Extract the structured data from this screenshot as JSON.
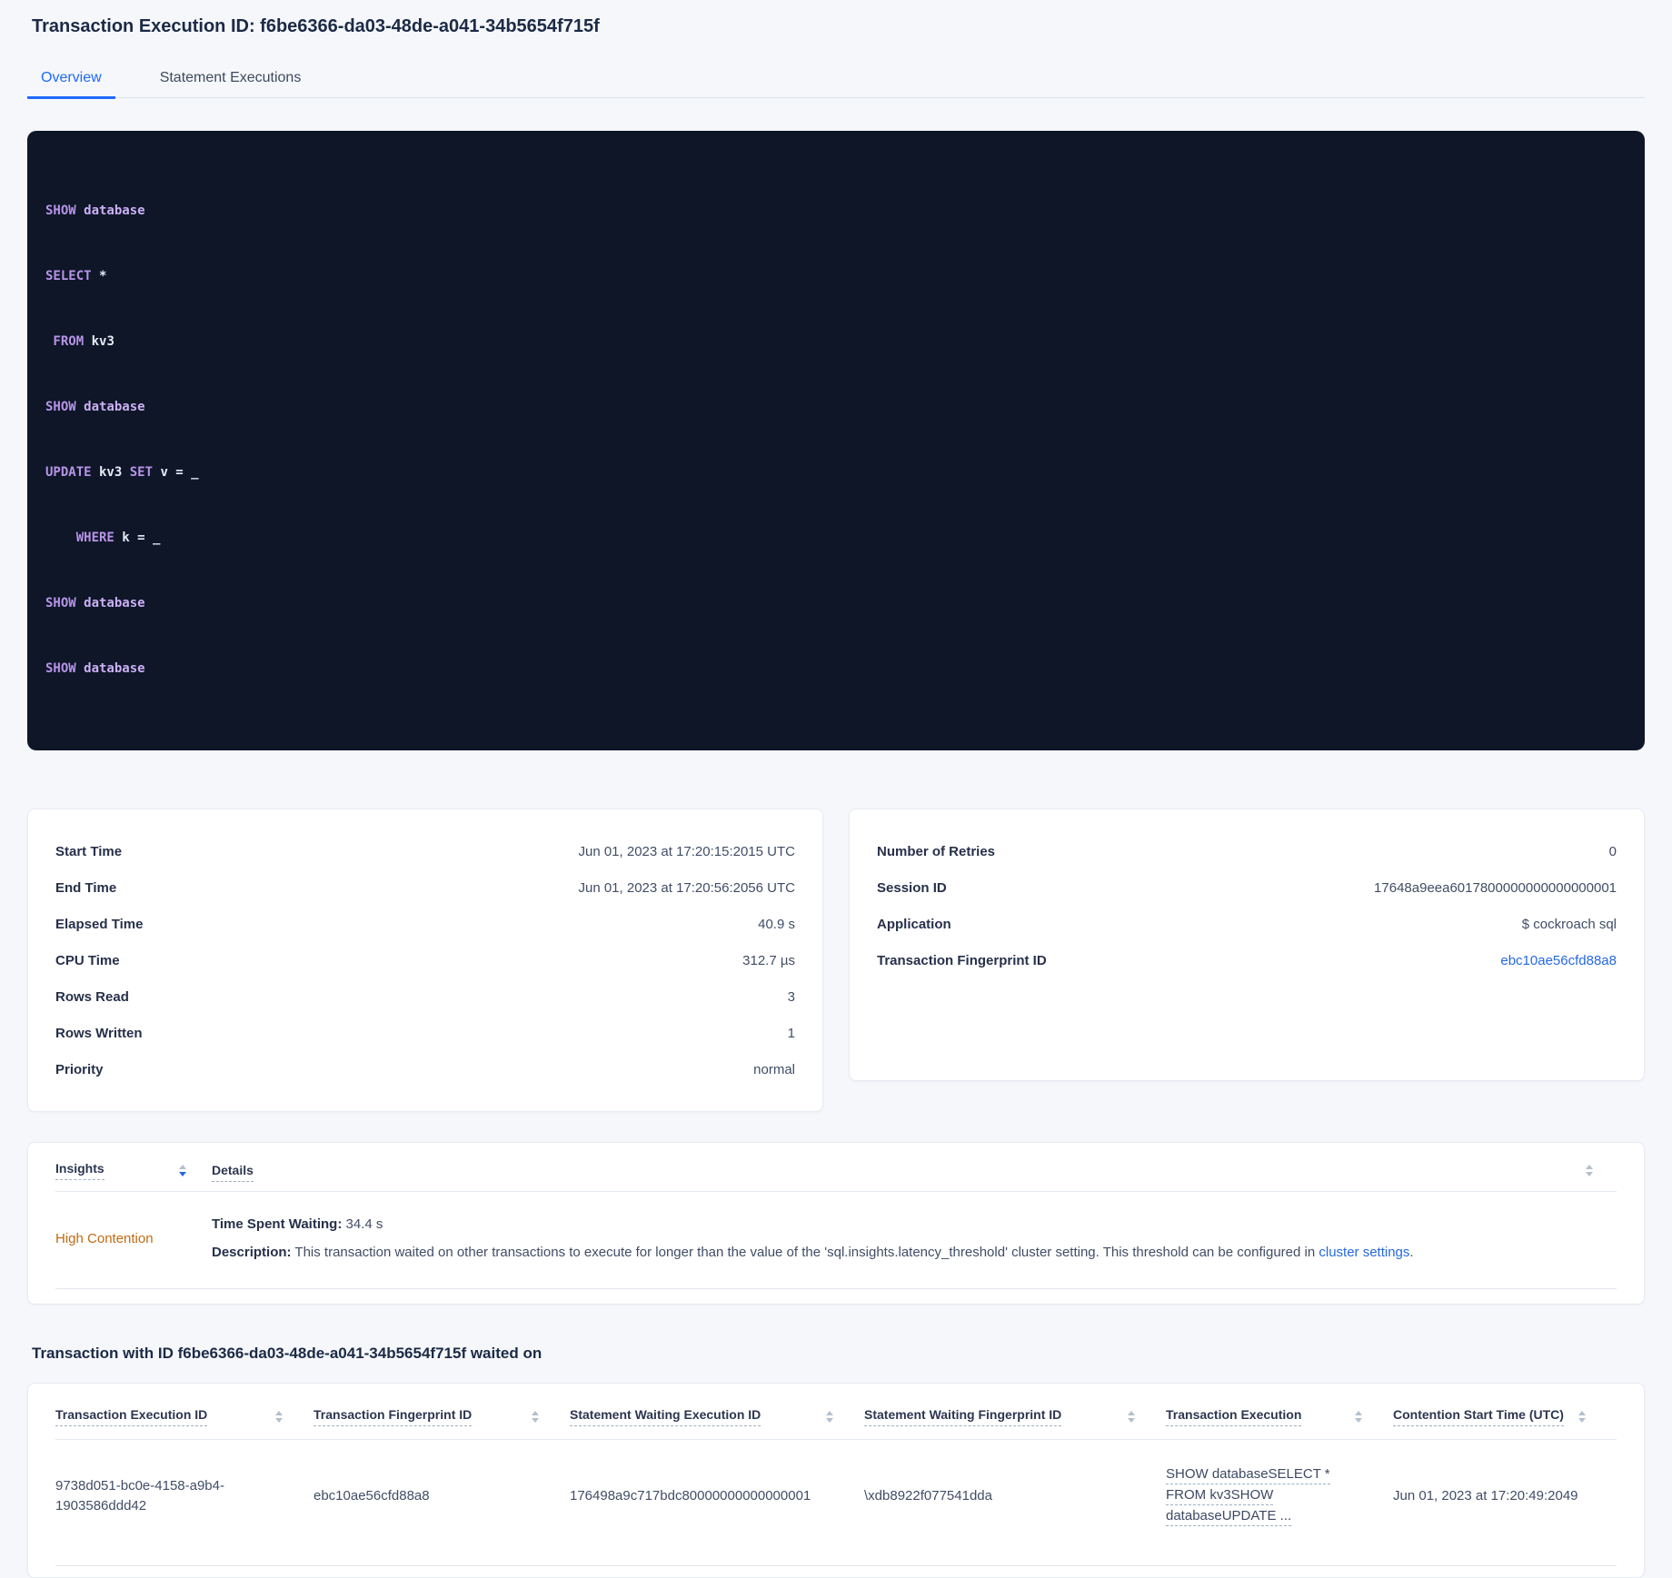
{
  "page": {
    "title": "Transaction Execution ID: f6be6366-da03-48de-a041-34b5654f715f"
  },
  "tabs": [
    {
      "label": "Overview",
      "active": true
    },
    {
      "label": "Statement Executions",
      "active": false
    }
  ],
  "sql": {
    "lines": [
      {
        "s": [
          {
            "t": "SHOW"
          },
          {
            "t": " database"
          }
        ]
      },
      {
        "s": [
          {
            "t": "SELECT"
          },
          {
            "t": " *"
          }
        ]
      },
      {
        "s": [
          {
            "t": " FROM"
          },
          {
            "t": " kv3"
          }
        ]
      },
      {
        "s": [
          {
            "t": "SHOW"
          },
          {
            "t": " database"
          }
        ]
      },
      {
        "s": [
          {
            "t": "UPDATE"
          },
          {
            "t": " kv3"
          },
          {
            "t": " SET"
          },
          {
            "t": " v = _"
          }
        ]
      },
      {
        "s": [
          {
            "t": "    WHERE"
          },
          {
            "t": " k = _"
          }
        ]
      },
      {
        "s": [
          {
            "t": "SHOW"
          },
          {
            "t": " database"
          }
        ]
      },
      {
        "s": [
          {
            "t": "SHOW"
          },
          {
            "t": " database"
          }
        ]
      }
    ]
  },
  "details_left": {
    "rows": [
      {
        "label": "Start Time",
        "value": "Jun 01, 2023 at 17:20:15:2015 UTC"
      },
      {
        "label": "End Time",
        "value": "Jun 01, 2023 at 17:20:56:2056 UTC"
      },
      {
        "label": "Elapsed Time",
        "value": "40.9 s"
      },
      {
        "label": "CPU Time",
        "value": "312.7 µs"
      },
      {
        "label": "Rows Read",
        "value": "3"
      },
      {
        "label": "Rows Written",
        "value": "1"
      },
      {
        "label": "Priority",
        "value": "normal"
      }
    ]
  },
  "details_right": {
    "rows": [
      {
        "label": "Number of Retries",
        "value": "0"
      },
      {
        "label": "Session ID",
        "value": "17648a9eea6017800000000000000001"
      },
      {
        "label": "Application",
        "value": "$ cockroach sql"
      },
      {
        "label": "Transaction Fingerprint ID",
        "value": "ebc10ae56cfd88a8"
      }
    ]
  },
  "insights": {
    "columns": [
      "Insights",
      "Details"
    ],
    "row": {
      "insight": "High Contention",
      "waiting_label": "Time Spent Waiting:",
      "waiting_value": " 34.4 s",
      "description_label": "Description:",
      "description_text": " This transaction waited on other transactions to execute for longer than the value of the 'sql.insights.latency_threshold' cluster setting. This threshold can be configured in ",
      "description_link": "cluster settings",
      "description_suffix": "."
    }
  },
  "waited_on": {
    "title": "Transaction with ID f6be6366-da03-48de-a041-34b5654f715f waited on",
    "columns": [
      "Transaction Execution ID",
      "Transaction Fingerprint ID",
      "Statement Waiting Execution ID",
      "Statement Waiting Fingerprint ID",
      "Transaction Execution",
      "Contention Start Time (UTC)"
    ],
    "row": {
      "transaction_execution_id": "9738d051-bc0e-4158-a9b4-1903586ddd42",
      "transaction_fingerprint_id": "ebc10ae56cfd88a8",
      "statement_waiting_execution_id": "176498a9c717bdc80000000000000001",
      "statement_waiting_fingerprint_id": "\\xdb8922f077541dda",
      "transaction_execution_lines": [
        "SHOW databaseSELECT *",
        "FROM kv3SHOW",
        "databaseUPDATE ..."
      ],
      "contention_start_time": "Jun 01, 2023 at 17:20:49:2049"
    }
  },
  "colors": {
    "page_background": "#f5f7fa",
    "heading_text": "#1c2a46",
    "accent_blue": "#2668e0",
    "tab_active_blue": "#1f69ff",
    "insight_warning_orange": "#c26a12",
    "code_background": "#0e1628",
    "code_keyword": "#b794e8",
    "code_keyword_secondary": "#cbb0f4",
    "code_identifier": "#e6ebf5"
  }
}
